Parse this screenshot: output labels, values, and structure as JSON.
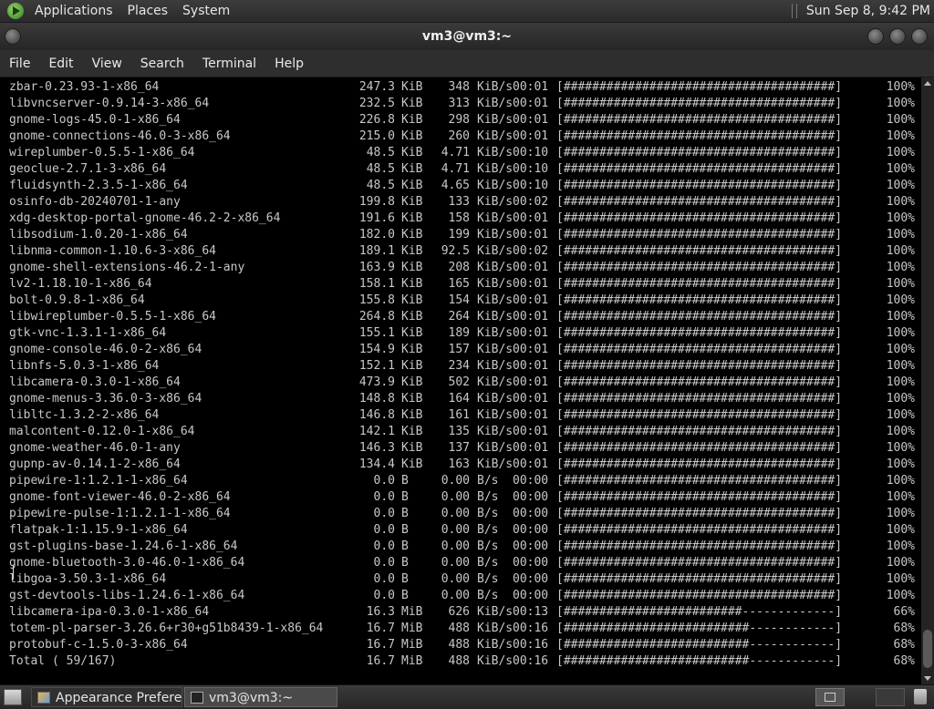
{
  "top_panel": {
    "menus": [
      "Applications",
      "Places",
      "System"
    ],
    "clock": "Sun Sep  8,  9:42 PM"
  },
  "window": {
    "title": "vm3@vm3:~"
  },
  "menubar": [
    "File",
    "Edit",
    "View",
    "Search",
    "Terminal",
    "Help"
  ],
  "terminal": {
    "rows": [
      {
        "name": "zbar-0.23.93-1-x86_64",
        "size": "247.3",
        "unit": "KiB",
        "rate": "348",
        "runit": "KiB/s",
        "time": "00:01",
        "bar": "[######################################]",
        "pct": "100%"
      },
      {
        "name": "libvncserver-0.9.14-3-x86_64",
        "size": "232.5",
        "unit": "KiB",
        "rate": "313",
        "runit": "KiB/s",
        "time": "00:01",
        "bar": "[######################################]",
        "pct": "100%"
      },
      {
        "name": "gnome-logs-45.0-1-x86_64",
        "size": "226.8",
        "unit": "KiB",
        "rate": "298",
        "runit": "KiB/s",
        "time": "00:01",
        "bar": "[######################################]",
        "pct": "100%"
      },
      {
        "name": "gnome-connections-46.0-3-x86_64",
        "size": "215.0",
        "unit": "KiB",
        "rate": "260",
        "runit": "KiB/s",
        "time": "00:01",
        "bar": "[######################################]",
        "pct": "100%"
      },
      {
        "name": "wireplumber-0.5.5-1-x86_64",
        "size": "48.5",
        "unit": "KiB",
        "rate": "4.71",
        "runit": "KiB/s",
        "time": "00:10",
        "bar": "[######################################]",
        "pct": "100%"
      },
      {
        "name": "geoclue-2.7.1-3-x86_64",
        "size": "48.5",
        "unit": "KiB",
        "rate": "4.71",
        "runit": "KiB/s",
        "time": "00:10",
        "bar": "[######################################]",
        "pct": "100%"
      },
      {
        "name": "fluidsynth-2.3.5-1-x86_64",
        "size": "48.5",
        "unit": "KiB",
        "rate": "4.65",
        "runit": "KiB/s",
        "time": "00:10",
        "bar": "[######################################]",
        "pct": "100%"
      },
      {
        "name": "osinfo-db-20240701-1-any",
        "size": "199.8",
        "unit": "KiB",
        "rate": "133",
        "runit": "KiB/s",
        "time": "00:02",
        "bar": "[######################################]",
        "pct": "100%"
      },
      {
        "name": "xdg-desktop-portal-gnome-46.2-2-x86_64",
        "size": "191.6",
        "unit": "KiB",
        "rate": "158",
        "runit": "KiB/s",
        "time": "00:01",
        "bar": "[######################################]",
        "pct": "100%"
      },
      {
        "name": "libsodium-1.0.20-1-x86_64",
        "size": "182.0",
        "unit": "KiB",
        "rate": "199",
        "runit": "KiB/s",
        "time": "00:01",
        "bar": "[######################################]",
        "pct": "100%"
      },
      {
        "name": "libnma-common-1.10.6-3-x86_64",
        "size": "189.1",
        "unit": "KiB",
        "rate": "92.5",
        "runit": "KiB/s",
        "time": "00:02",
        "bar": "[######################################]",
        "pct": "100%"
      },
      {
        "name": "gnome-shell-extensions-46.2-1-any",
        "size": "163.9",
        "unit": "KiB",
        "rate": "208",
        "runit": "KiB/s",
        "time": "00:01",
        "bar": "[######################################]",
        "pct": "100%"
      },
      {
        "name": "lv2-1.18.10-1-x86_64",
        "size": "158.1",
        "unit": "KiB",
        "rate": "165",
        "runit": "KiB/s",
        "time": "00:01",
        "bar": "[######################################]",
        "pct": "100%"
      },
      {
        "name": "bolt-0.9.8-1-x86_64",
        "size": "155.8",
        "unit": "KiB",
        "rate": "154",
        "runit": "KiB/s",
        "time": "00:01",
        "bar": "[######################################]",
        "pct": "100%"
      },
      {
        "name": "libwireplumber-0.5.5-1-x86_64",
        "size": "264.8",
        "unit": "KiB",
        "rate": "264",
        "runit": "KiB/s",
        "time": "00:01",
        "bar": "[######################################]",
        "pct": "100%"
      },
      {
        "name": "gtk-vnc-1.3.1-1-x86_64",
        "size": "155.1",
        "unit": "KiB",
        "rate": "189",
        "runit": "KiB/s",
        "time": "00:01",
        "bar": "[######################################]",
        "pct": "100%"
      },
      {
        "name": "gnome-console-46.0-2-x86_64",
        "size": "154.9",
        "unit": "KiB",
        "rate": "157",
        "runit": "KiB/s",
        "time": "00:01",
        "bar": "[######################################]",
        "pct": "100%"
      },
      {
        "name": "libnfs-5.0.3-1-x86_64",
        "size": "152.1",
        "unit": "KiB",
        "rate": "234",
        "runit": "KiB/s",
        "time": "00:01",
        "bar": "[######################################]",
        "pct": "100%"
      },
      {
        "name": "libcamera-0.3.0-1-x86_64",
        "size": "473.9",
        "unit": "KiB",
        "rate": "502",
        "runit": "KiB/s",
        "time": "00:01",
        "bar": "[######################################]",
        "pct": "100%"
      },
      {
        "name": "gnome-menus-3.36.0-3-x86_64",
        "size": "148.8",
        "unit": "KiB",
        "rate": "164",
        "runit": "KiB/s",
        "time": "00:01",
        "bar": "[######################################]",
        "pct": "100%"
      },
      {
        "name": "libltc-1.3.2-2-x86_64",
        "size": "146.8",
        "unit": "KiB",
        "rate": "161",
        "runit": "KiB/s",
        "time": "00:01",
        "bar": "[######################################]",
        "pct": "100%"
      },
      {
        "name": "malcontent-0.12.0-1-x86_64",
        "size": "142.1",
        "unit": "KiB",
        "rate": "135",
        "runit": "KiB/s",
        "time": "00:01",
        "bar": "[######################################]",
        "pct": "100%"
      },
      {
        "name": "gnome-weather-46.0-1-any",
        "size": "146.3",
        "unit": "KiB",
        "rate": "137",
        "runit": "KiB/s",
        "time": "00:01",
        "bar": "[######################################]",
        "pct": "100%"
      },
      {
        "name": "gupnp-av-0.14.1-2-x86_64",
        "size": "134.4",
        "unit": "KiB",
        "rate": "163",
        "runit": "KiB/s",
        "time": "00:01",
        "bar": "[######################################]",
        "pct": "100%"
      },
      {
        "name": "pipewire-1:1.2.1-1-x86_64",
        "size": "0.0",
        "unit": "B",
        "rate": "0.00",
        "runit": "B/s",
        "time": "00:00",
        "bar": "[######################################]",
        "pct": "100%"
      },
      {
        "name": "gnome-font-viewer-46.0-2-x86_64",
        "size": "0.0",
        "unit": "B",
        "rate": "0.00",
        "runit": "B/s",
        "time": "00:00",
        "bar": "[######################################]",
        "pct": "100%"
      },
      {
        "name": "pipewire-pulse-1:1.2.1-1-x86_64",
        "size": "0.0",
        "unit": "B",
        "rate": "0.00",
        "runit": "B/s",
        "time": "00:00",
        "bar": "[######################################]",
        "pct": "100%"
      },
      {
        "name": "flatpak-1:1.15.9-1-x86_64",
        "size": "0.0",
        "unit": "B",
        "rate": "0.00",
        "runit": "B/s",
        "time": "00:00",
        "bar": "[######################################]",
        "pct": "100%"
      },
      {
        "name": "gst-plugins-base-1.24.6-1-x86_64",
        "size": "0.0",
        "unit": "B",
        "rate": "0.00",
        "runit": "B/s",
        "time": "00:00",
        "bar": "[######################################]",
        "pct": "100%"
      },
      {
        "name": "gnome-bluetooth-3.0-46.0-1-x86_64",
        "size": "0.0",
        "unit": "B",
        "rate": "0.00",
        "runit": "B/s",
        "time": "00:00",
        "bar": "[######################################]",
        "pct": "100%"
      },
      {
        "name": "libgoa-3.50.3-1-x86_64",
        "size": "0.0",
        "unit": "B",
        "rate": "0.00",
        "runit": "B/s",
        "time": "00:00",
        "bar": "[######################################]",
        "pct": "100%"
      },
      {
        "name": "gst-devtools-libs-1.24.6-1-x86_64",
        "size": "0.0",
        "unit": "B",
        "rate": "0.00",
        "runit": "B/s",
        "time": "00:00",
        "bar": "[######################################]",
        "pct": "100%"
      },
      {
        "name": "libcamera-ipa-0.3.0-1-x86_64",
        "size": "16.3",
        "unit": "MiB",
        "rate": "626",
        "runit": "KiB/s",
        "time": "00:13",
        "bar": "[#########################-------------]",
        "pct": "66%"
      },
      {
        "name": "totem-pl-parser-3.26.6+r30+g51b8439-1-x86_64",
        "size": "16.7",
        "unit": "MiB",
        "rate": "488",
        "runit": "KiB/s",
        "time": "00:16",
        "bar": "[##########################------------]",
        "pct": "68%"
      },
      {
        "name": "protobuf-c-1.5.0-3-x86_64",
        "size": "16.7",
        "unit": "MiB",
        "rate": "488",
        "runit": "KiB/s",
        "time": "00:16",
        "bar": "[##########################------------]",
        "pct": "68%"
      },
      {
        "name": "Total ( 59/167)",
        "size": "16.7",
        "unit": "MiB",
        "rate": "488",
        "runit": "KiB/s",
        "time": "00:16",
        "bar": "[##########################------------]",
        "pct": "68%"
      }
    ]
  },
  "taskbar": {
    "tasks": [
      {
        "label": "Appearance Prefere..."
      },
      {
        "label": "vm3@vm3:~"
      }
    ]
  }
}
